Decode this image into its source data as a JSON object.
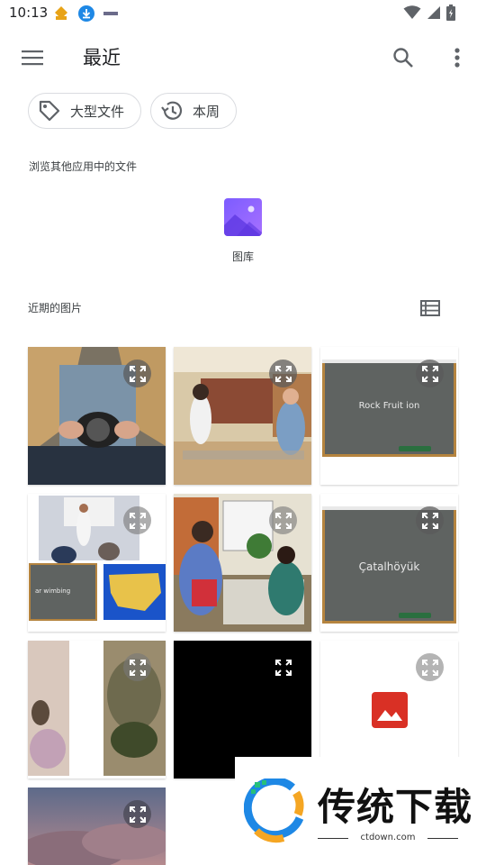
{
  "status_bar": {
    "time": "10:13",
    "icons": [
      "app-notification-icon",
      "download-icon",
      "notification-icon",
      "wifi-icon",
      "signal-icon",
      "battery-icon"
    ]
  },
  "toolbar": {
    "title": "最近",
    "icons": [
      "menu-icon",
      "search-icon",
      "more-vert-icon"
    ]
  },
  "chips": [
    {
      "label": "大型文件",
      "icon": "tag-icon"
    },
    {
      "label": "本周",
      "icon": "history-icon"
    }
  ],
  "browse": {
    "label": "浏览其他应用中的文件",
    "apps": [
      {
        "label": "图库",
        "icon": "gallery-icon",
        "color": "#8c6bff"
      }
    ]
  },
  "recent": {
    "label": "近期的图片",
    "view_toggle_icon": "list-view-icon"
  },
  "thumbnails": [
    {
      "subject": "camera-photo"
    },
    {
      "subject": "library-photo"
    },
    {
      "subject": "chalkboard",
      "text": "Rock Fruit ion"
    },
    {
      "subject": "classroom-map",
      "text": "ar wimbing"
    },
    {
      "subject": "office-photo"
    },
    {
      "subject": "chalkboard",
      "text": "Çatalhöyük"
    },
    {
      "subject": "split-photo"
    },
    {
      "subject": "black-image"
    },
    {
      "subject": "image-placeholder",
      "color": "#d93025"
    },
    {
      "subject": "sky-photo"
    }
  ],
  "watermark": {
    "text": "传统下载",
    "url": "ctdown.com"
  }
}
